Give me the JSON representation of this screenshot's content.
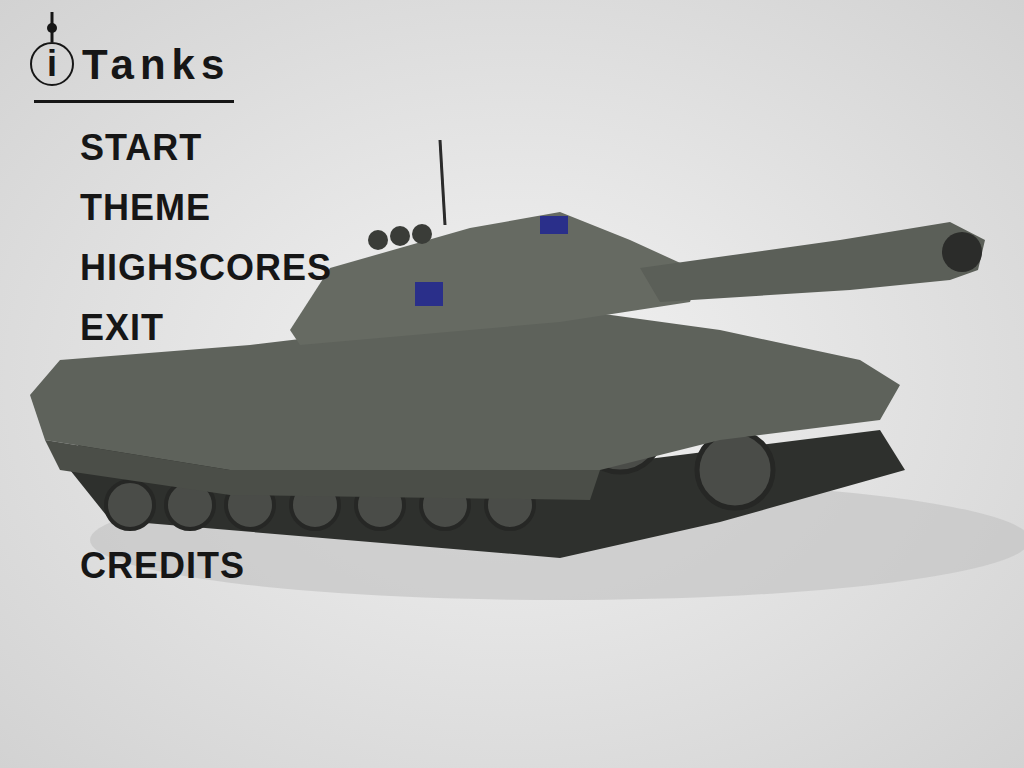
{
  "logo": {
    "icon_letter": "i",
    "name": "Tanks"
  },
  "menu": [
    {
      "label": "START"
    },
    {
      "label": "THEME"
    },
    {
      "label": "HIGHSCORES"
    },
    {
      "label": "EXIT"
    }
  ],
  "footer_menu": [
    {
      "label": "CREDITS"
    }
  ]
}
